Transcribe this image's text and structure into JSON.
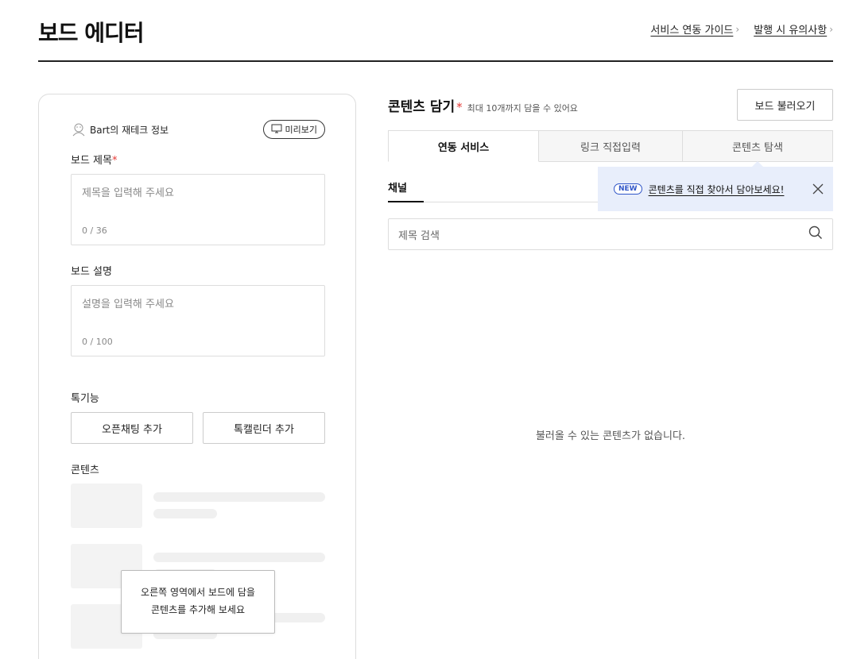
{
  "header": {
    "title": "보드 에디터",
    "links": [
      {
        "label": "서비스 연동 가이드"
      },
      {
        "label": "발행 시 유의사항"
      }
    ]
  },
  "left": {
    "profile_name": "Bart의 재테크 정보",
    "preview_label": "미리보기",
    "board_title": {
      "label": "보드 제목",
      "required": "*",
      "placeholder": "제목을 입력해 주세요",
      "count": "0 / 36"
    },
    "board_desc": {
      "label": "보드 설명",
      "placeholder": "설명을 입력해 주세요",
      "count": "0 / 100"
    },
    "talk_features": {
      "label": "톡기능",
      "buttons": [
        "오픈채팅 추가",
        "톡캘린더 추가"
      ]
    },
    "contents_label": "콘텐츠",
    "tooltip_line1": "오른쪽 영역에서 보드에 담을",
    "tooltip_line2": "콘텐츠를 추가해 보세요"
  },
  "right": {
    "section_title": "콘텐츠 담기",
    "section_required": "*",
    "section_sub": "최대 10개까지 담을 수 있어요",
    "load_button": "보드 불러오기",
    "tabs": [
      {
        "label": "연동 서비스",
        "active": true
      },
      {
        "label": "링크 직접입력",
        "active": false
      },
      {
        "label": "콘텐츠 탐색",
        "active": false
      }
    ],
    "channel_label": "채널",
    "promo": {
      "badge": "NEW",
      "text": "콘텐츠를 직접 찾아서 담아보세요!"
    },
    "search_placeholder": "제목 검색",
    "empty_message": "불러올 수 있는 콘텐츠가 없습니다."
  },
  "colors": {
    "required": "#e53935",
    "promo_bg": "#e8eefb",
    "badge": "#2f55c8"
  }
}
